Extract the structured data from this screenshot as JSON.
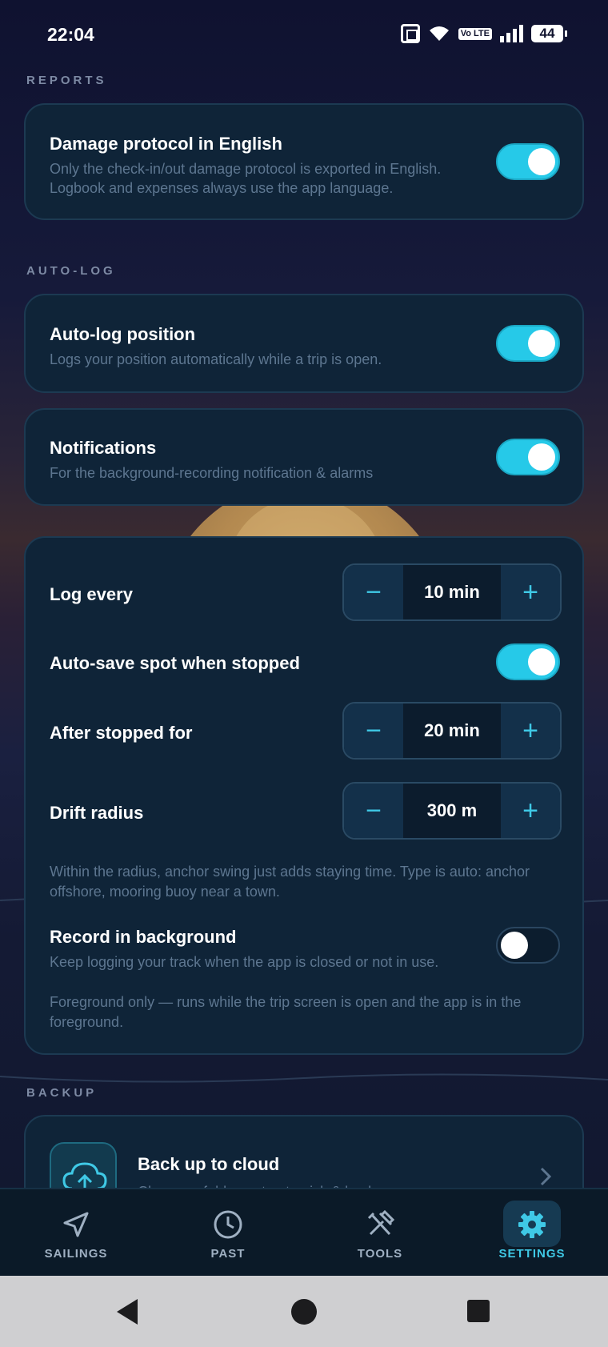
{
  "status_bar": {
    "time": "22:04",
    "network": "Vo LTE",
    "battery": "44"
  },
  "reports": {
    "section_label": "REPORTS",
    "damage_protocol": {
      "title": "Damage protocol in English",
      "subtitle_line1": "Only the check-in/out damage protocol is exported in English.",
      "subtitle_line2": "Logbook and expenses always use the app language.",
      "enabled": true
    }
  },
  "auto_log": {
    "section_label": "AUTO-LOG",
    "auto_log_position": {
      "title": "Auto-log position",
      "subtitle": "Logs your position automatically while a trip is open.",
      "enabled": true
    },
    "notifications": {
      "title": "Notifications",
      "subtitle": "For the background-recording notification & alarms",
      "enabled": true
    },
    "log_every": {
      "label": "Log every",
      "value": "10 min"
    },
    "auto_save_spot": {
      "label": "Auto-save spot when stopped",
      "enabled": true
    },
    "after_stopped_for": {
      "label": "After stopped for",
      "value": "20 min"
    },
    "drift_radius": {
      "label": "Drift radius",
      "value": "300 m"
    },
    "drift_note_line1": "Within the radius, anchor swing just adds staying time. Type is auto: anchor",
    "drift_note_line2": "offshore, mooring buoy near a town.",
    "record_background": {
      "title": "Record in background",
      "subtitle": "Keep logging your track when the app is closed or not in use.",
      "enabled": false
    },
    "foreground_note_line1": "Foreground only — runs while the trip screen is open and the app is in the",
    "foreground_note_line2": "foreground."
  },
  "backup": {
    "section_label": "BACKUP",
    "cloud": {
      "title": "Back up to cloud",
      "subtitle": "Choose a folder — tap to pick & back up"
    }
  },
  "stepper_symbols": {
    "minus": "−",
    "plus": "+"
  },
  "bottom_nav": {
    "sailings": "SAILINGS",
    "past": "PAST",
    "tools": "TOOLS",
    "settings": "SETTINGS"
  },
  "colors": {
    "accent": "#26c9e8",
    "card_bg": "#0f2438",
    "active_nav": "#3fc9e6"
  }
}
